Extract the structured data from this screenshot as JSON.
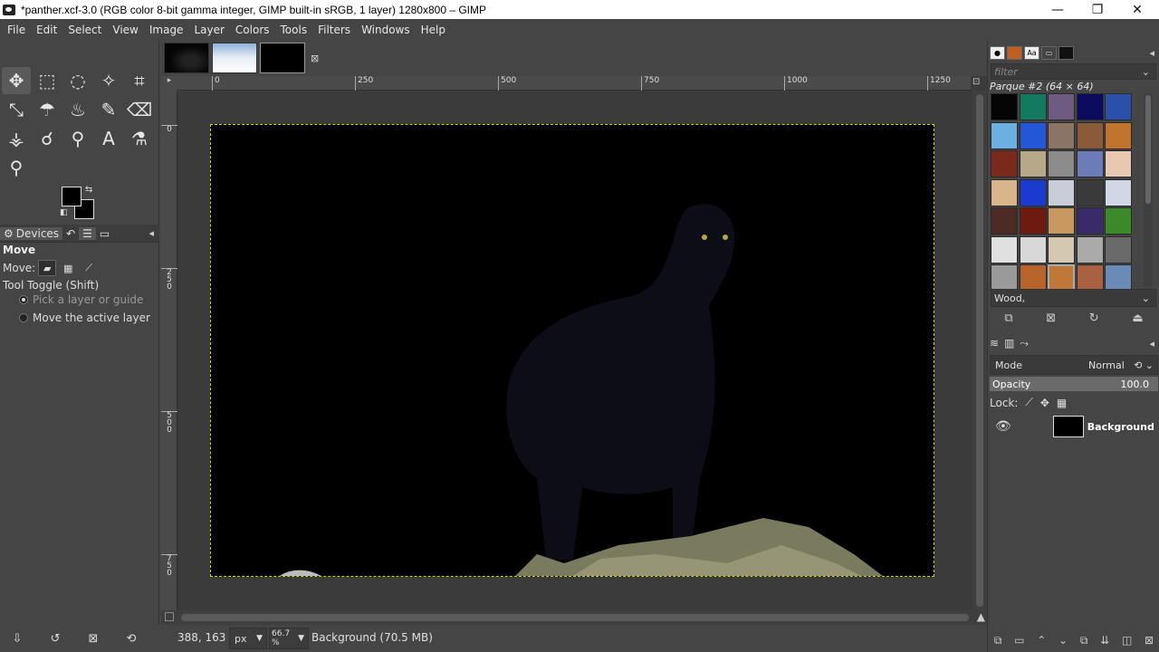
{
  "window": {
    "title": "*panther.xcf-3.0 (RGB color 8-bit gamma integer, GIMP built-in sRGB, 1 layer) 1280x800 – GIMP",
    "minimize": "—",
    "restore": "❐",
    "close": "✕"
  },
  "menu": [
    "File",
    "Edit",
    "Select",
    "View",
    "Image",
    "Layer",
    "Colors",
    "Tools",
    "Filters",
    "Windows",
    "Help"
  ],
  "toolbox": {
    "tools": [
      {
        "name": "move-tool-icon",
        "glyph": "✥"
      },
      {
        "name": "rect-select-icon",
        "glyph": "⬚"
      },
      {
        "name": "free-select-icon",
        "glyph": "◌"
      },
      {
        "name": "fuzzy-select-icon",
        "glyph": "✧"
      },
      {
        "name": "crop-icon",
        "glyph": "⌗"
      },
      {
        "name": "transform-icon",
        "glyph": "⤡"
      },
      {
        "name": "warp-icon",
        "glyph": "☂"
      },
      {
        "name": "bucket-fill-icon",
        "glyph": "♨"
      },
      {
        "name": "paintbrush-icon",
        "glyph": "✎"
      },
      {
        "name": "eraser-icon",
        "glyph": "⌫"
      },
      {
        "name": "clone-icon",
        "glyph": "⚶"
      },
      {
        "name": "smudge-icon",
        "glyph": "☌"
      },
      {
        "name": "path-icon",
        "glyph": "⚲"
      },
      {
        "name": "text-icon",
        "glyph": "A"
      },
      {
        "name": "color-picker-icon",
        "glyph": "⚗"
      },
      {
        "name": "zoom-icon",
        "glyph": "⚲"
      }
    ]
  },
  "dock": {
    "devices_tab": "Devices"
  },
  "tool_options": {
    "title": "Move",
    "move_label": "Move:",
    "toggle_label": "Tool Toggle  (Shift)",
    "option_pick": "Pick a layer or guide",
    "option_active": "Move the active layer"
  },
  "ruler": {
    "h_marks": [
      "0",
      "250",
      "500",
      "750",
      "1000",
      "1250"
    ],
    "v_marks": [
      "0",
      "2\n5\n0",
      "5\n0\n0",
      "7\n5\n0"
    ]
  },
  "status": {
    "coords": "388, 163",
    "unit": "px",
    "zoom": "66.7 %",
    "layer_info": "Background (70.5 MB)"
  },
  "patterns": {
    "filter_placeholder": "filter",
    "current": "Parque #2 (64 × 64)",
    "selected_name": "Wood,",
    "colors": [
      "#050505",
      "#127a5e",
      "#6f5a82",
      "#0c0c5e",
      "#2a4fa8",
      "#6bb0e0",
      "#2357d8",
      "#8a7466",
      "#8a5a3a",
      "#c0742e",
      "#7a2a1a",
      "#b8a88a",
      "#8c8c8c",
      "#6b7cb8",
      "#e8c8b0",
      "#d8b48a",
      "#1a3ad0",
      "#c8ccd8",
      "#3a3a3a",
      "#d0d8e8",
      "#4a2a22",
      "#6e1a10",
      "#c89860",
      "#3a2a6a",
      "#3a8a2a",
      "#e0e0e0",
      "#d8d8d8",
      "#d4c8b0",
      "#aaaaaa",
      "#6a6a6a",
      "#9a9a9a",
      "#b8642a",
      "#c07838",
      "#a86040",
      "#6a8ab8"
    ]
  },
  "layers": {
    "mode_label": "Mode",
    "mode_value": "Normal",
    "opacity_label": "Opacity",
    "opacity_value": "100.0",
    "lock_label": "Lock:",
    "layer_name": "Background"
  }
}
